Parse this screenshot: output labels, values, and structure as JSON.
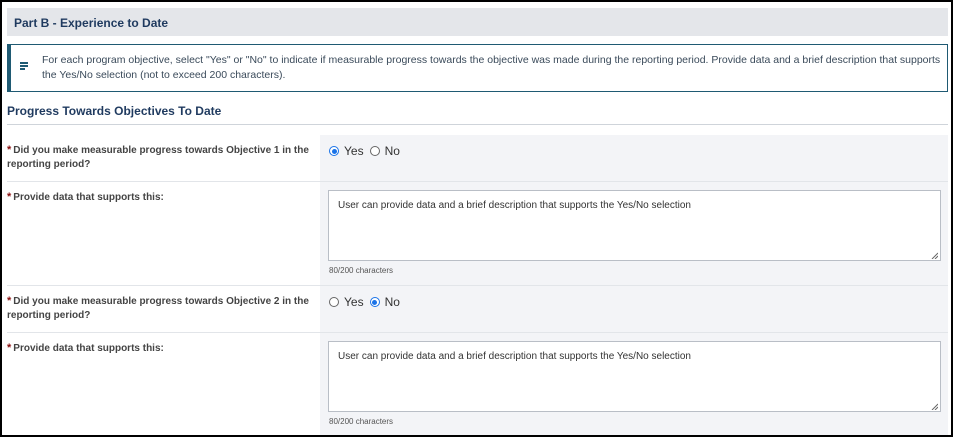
{
  "part_header": "Part B - Experience to Date",
  "info": "For each program objective, select \"Yes\" or \"No\" to indicate if measurable progress towards the objective was made during the reporting period. Provide data and a brief description that supports the Yes/No selection (not to exceed 200 characters).",
  "section_title": "Progress Towards Objectives To Date",
  "required_mark": "*",
  "objectives": [
    {
      "question": "Did you make measurable progress towards Objective 1 in the reporting period?",
      "yes_label": "Yes",
      "no_label": "No",
      "selected": "Yes",
      "data_label": "Provide data that supports this:",
      "data_value": "User can provide data and a brief description that supports the Yes/No selection",
      "counter": "80/200 characters"
    },
    {
      "question": "Did you make measurable progress towards Objective 2 in the reporting period?",
      "yes_label": "Yes",
      "no_label": "No",
      "selected": "No",
      "data_label": "Provide data that supports this:",
      "data_value": "User can provide data and a brief description that supports the Yes/No selection",
      "counter": "80/200 characters"
    }
  ],
  "icons": {
    "info": "note-icon",
    "resize": "resize-handle-icon"
  },
  "colors": {
    "accent": "#1a73e8",
    "heading": "#1f3a5f",
    "required": "#8b1010",
    "info_border": "#1f5a73"
  }
}
